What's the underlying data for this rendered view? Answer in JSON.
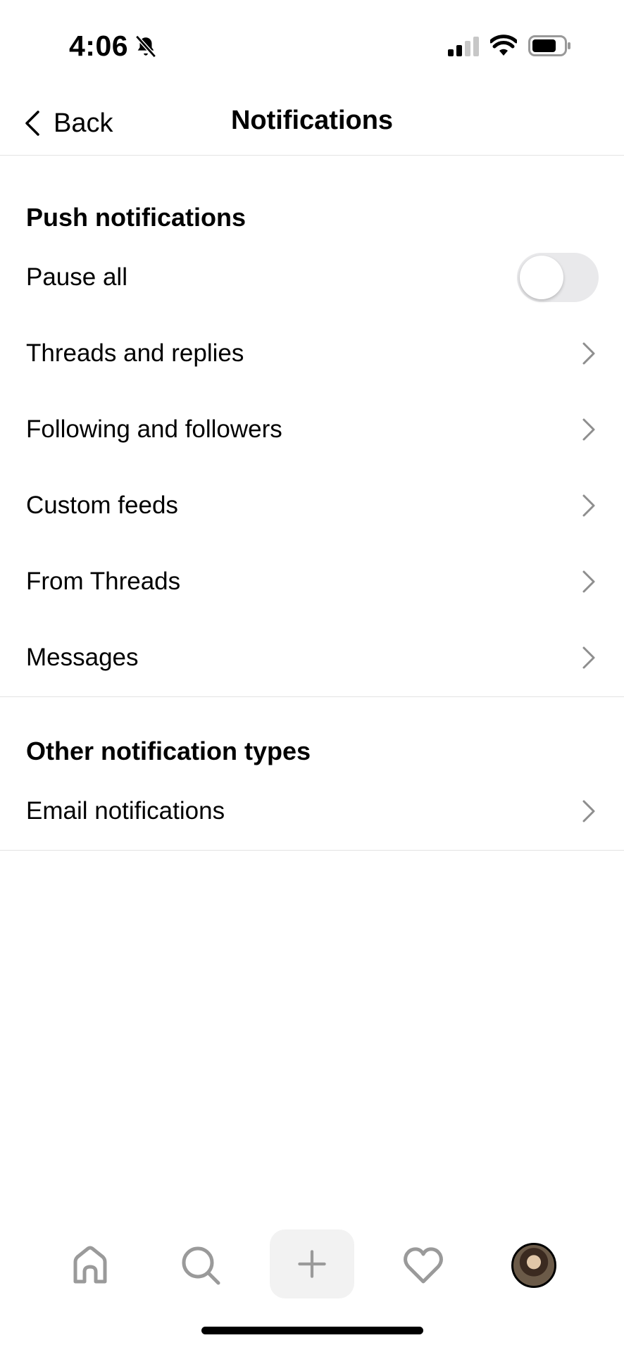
{
  "status": {
    "time": "4:06"
  },
  "header": {
    "back_label": "Back",
    "title": "Notifications"
  },
  "push": {
    "heading": "Push notifications",
    "pause_all": {
      "label": "Pause all",
      "on": false
    },
    "items": [
      {
        "label": "Threads and replies"
      },
      {
        "label": "Following and followers"
      },
      {
        "label": "Custom feeds"
      },
      {
        "label": "From Threads"
      },
      {
        "label": "Messages"
      }
    ]
  },
  "other": {
    "heading": "Other notification types",
    "items": [
      {
        "label": "Email notifications"
      }
    ]
  },
  "tabbar": {
    "icons": [
      "home-icon",
      "search-icon",
      "compose-icon",
      "heart-icon",
      "profile-avatar"
    ]
  },
  "colors": {
    "toggle_off": "#e9e9eb",
    "chevron": "#8e8e8e",
    "divider": "#e3e3e3",
    "tab_icon": "#9a9a9a"
  }
}
